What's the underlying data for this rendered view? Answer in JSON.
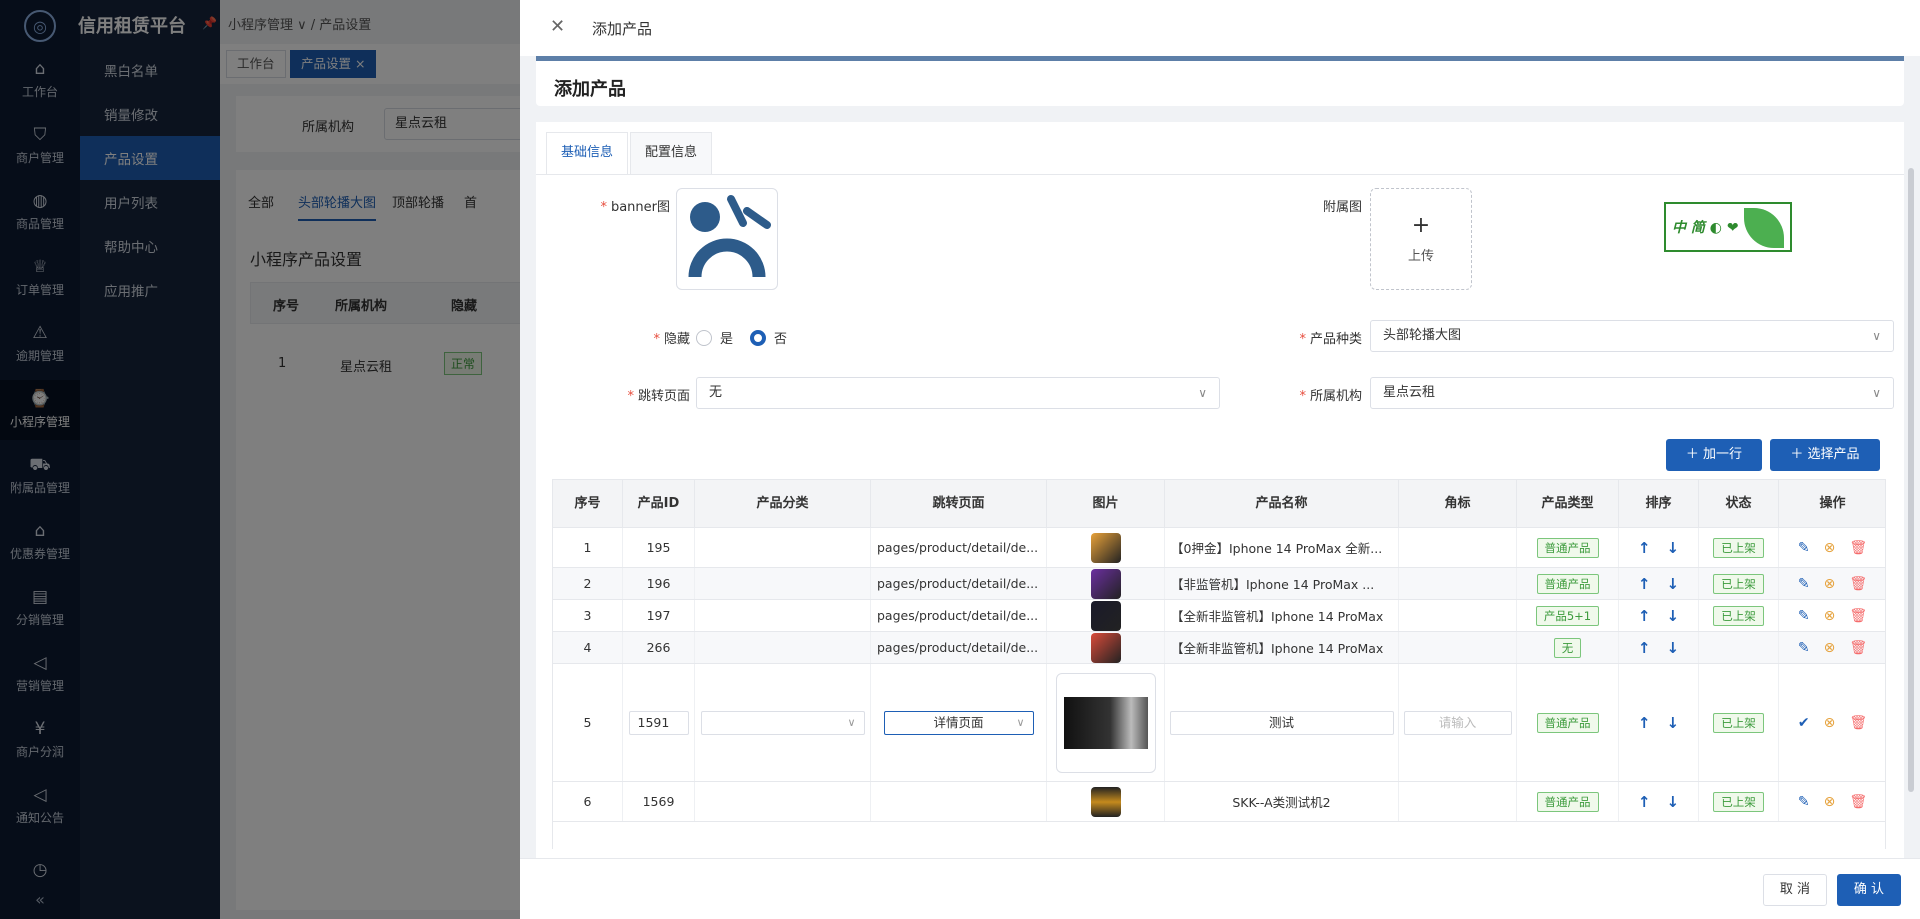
{
  "app": {
    "brand": "信用租赁平台"
  },
  "rail": [
    {
      "label": "工作台",
      "icon": "⌂"
    },
    {
      "label": "商户管理",
      "icon": "⛉"
    },
    {
      "label": "商品管理",
      "icon": "◍"
    },
    {
      "label": "订单管理",
      "icon": "♕"
    },
    {
      "label": "逾期管理",
      "icon": "⚠"
    },
    {
      "label": "小程序管理",
      "icon": "⌚"
    },
    {
      "label": "附属品管理",
      "icon": "⛟"
    },
    {
      "label": "优惠券管理",
      "icon": "⌂"
    },
    {
      "label": "分销管理",
      "icon": "▤"
    },
    {
      "label": "营销管理",
      "icon": "◁"
    },
    {
      "label": "商户分润",
      "icon": "¥"
    },
    {
      "label": "通知公告",
      "icon": "◁"
    },
    {
      "label": "",
      "icon": "◷"
    }
  ],
  "collapse_icon": "«",
  "submenu": [
    "黑白名单",
    "销量修改",
    "产品设置",
    "用户列表",
    "帮助中心",
    "应用推广"
  ],
  "bg": {
    "crumb": "小程序管理 ∨ / 产品设置",
    "tags": [
      "工作台",
      "产品设置 ×"
    ],
    "filter_label": "所属机构",
    "filter_value": "星点云租",
    "tabs": [
      "全部",
      "头部轮播大图",
      "顶部轮播",
      "首"
    ],
    "section_title": "小程序产品设置",
    "headers": [
      "序号",
      "所属机构",
      "隐藏"
    ],
    "row": [
      "1",
      "星点云租",
      "正常"
    ]
  },
  "drawer": {
    "close_icon": "✕",
    "title": "添加产品",
    "card_title": "添加产品",
    "tabs": [
      "基础信息",
      "配置信息"
    ],
    "badge_text": "中 简 ◐ ❤",
    "banner_label": "banner图",
    "attach_label": "附属图",
    "upload_plus": "+",
    "upload_text": "上传",
    "hide_label": "隐藏",
    "hide_yes": "是",
    "hide_no": "否",
    "kind_label": "产品种类",
    "kind_value": "头部轮播大图",
    "jump_label": "跳转页面",
    "jump_value": "无",
    "org_label": "所属机构",
    "org_value": "星点云租",
    "add_row": "＋  加一行",
    "select_product": "＋  选择产品",
    "cancel": "取 消",
    "confirm": "确 认"
  },
  "table": {
    "headers": [
      "序号",
      "产品ID",
      "产品分类",
      "跳转页面",
      "图片",
      "产品名称",
      "角标",
      "产品类型",
      "排序",
      "状态",
      "操作"
    ],
    "rows": [
      {
        "no": "1",
        "id": "195",
        "cat": "",
        "page": "pages/product/detail/de...",
        "name": "【0押金】Iphone 14 ProMax 全新...",
        "corner": "",
        "type": "普通产品",
        "status": "已上架",
        "color": "#e8a23a"
      },
      {
        "no": "2",
        "id": "196",
        "cat": "",
        "page": "pages/product/detail/de...",
        "name": "【非监管机】Iphone 14 ProMax ...",
        "corner": "",
        "type": "普通产品",
        "status": "已上架",
        "color": "#6b2fa0"
      },
      {
        "no": "3",
        "id": "197",
        "cat": "",
        "page": "pages/product/detail/de...",
        "name": "【全新非监管机】Iphone 14 ProMax",
        "corner": "",
        "type": "产品5+1",
        "status": "已上架",
        "color": "#1a1a2a"
      },
      {
        "no": "4",
        "id": "266",
        "cat": "",
        "page": "pages/product/detail/de...",
        "name": "【全新非监管机】Iphone 14 ProMax",
        "corner": "",
        "type": "无",
        "status": "",
        "color": "#d94b3a"
      }
    ],
    "edit_row": {
      "no": "5",
      "id": "1591",
      "cat": "",
      "page": "详情页面",
      "name": "测试",
      "corner_placeholder": "请输入",
      "type": "普通产品",
      "status": "已上架"
    },
    "last_row": {
      "no": "6",
      "id": "1569",
      "page": "",
      "name": "SKK--A类测试机2",
      "type": "普通产品",
      "status": "已上架"
    },
    "icons": {
      "up": "↑",
      "down": "↓",
      "edit": "✎",
      "cancel": "⊗",
      "delete": "🗑",
      "ok": "✔"
    }
  }
}
